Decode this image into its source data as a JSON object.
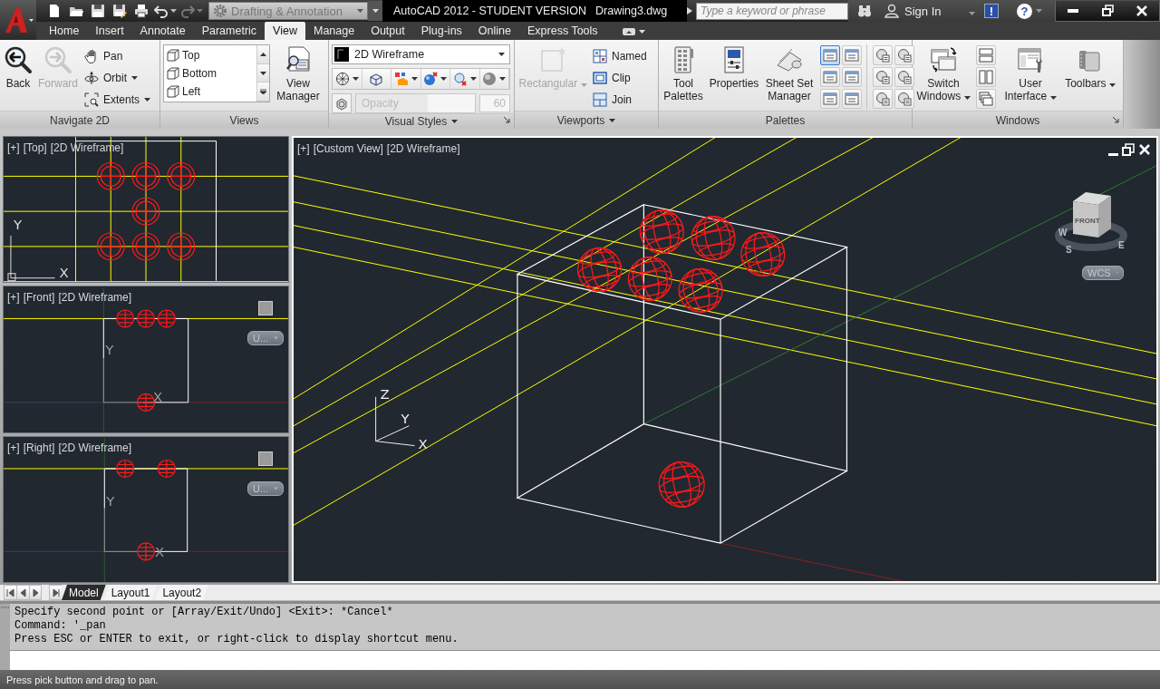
{
  "quick_access": {
    "tools": [
      {
        "kind": "new",
        "disabled": false,
        "dropdown": false
      },
      {
        "kind": "open",
        "disabled": false,
        "dropdown": false
      },
      {
        "kind": "save",
        "disabled": false,
        "dropdown": false
      },
      {
        "kind": "save_as",
        "disabled": false,
        "dropdown": false
      },
      {
        "kind": "print",
        "disabled": false,
        "dropdown": false
      },
      {
        "kind": "undo",
        "disabled": false,
        "dropdown": true
      },
      {
        "kind": "redo",
        "disabled": true,
        "dropdown": true
      }
    ],
    "workspace": "Drafting & Annotation"
  },
  "title": "AutoCAD 2012 - STUDENT VERSION",
  "document": "Drawing3.dwg",
  "search": {
    "placeholder": "Type a keyword or phrase"
  },
  "sign_in": "Sign In",
  "alert": "!",
  "help": "?",
  "tabs": [
    {
      "label": "Home",
      "selected": false
    },
    {
      "label": "Insert",
      "selected": false
    },
    {
      "label": "Annotate",
      "selected": false
    },
    {
      "label": "Parametric",
      "selected": false
    },
    {
      "label": "View",
      "selected": true
    },
    {
      "label": "Manage",
      "selected": false
    },
    {
      "label": "Output",
      "selected": false
    },
    {
      "label": "Plug-ins",
      "selected": false
    },
    {
      "label": "Online",
      "selected": false
    },
    {
      "label": "Express Tools",
      "selected": false
    }
  ],
  "ribbon": {
    "panels": [
      {
        "title": "Navigate 2D",
        "menu": false,
        "launcher": false,
        "columns": [
          {
            "kind": "large",
            "label": "Back",
            "disabled": false,
            "dropdown": false
          },
          {
            "kind": "large",
            "label": "Forward",
            "disabled": true,
            "dropdown": false
          },
          {
            "kind": "stack",
            "items": [
              {
                "label": "Pan",
                "dropdown": false
              },
              {
                "label": "Orbit",
                "dropdown": true
              },
              {
                "label": "Extents",
                "dropdown": true
              }
            ]
          }
        ]
      },
      {
        "title": "Views",
        "menu": false,
        "launcher": false,
        "columns": [
          {
            "kind": "list",
            "entries": [
              "Top",
              "Bottom",
              "Left"
            ]
          },
          {
            "kind": "large",
            "label": "View Manager",
            "disabled": false,
            "dropdown": false
          }
        ]
      },
      {
        "title": "Visual Styles",
        "menu": true,
        "launcher": true,
        "columns": [
          {
            "kind": "styles",
            "style": "2D Wireframe",
            "tools": [
              {
                "dropdown": true
              },
              {
                "dropdown": false
              },
              {
                "dropdown": true
              },
              {
                "dropdown": true
              },
              {
                "dropdown": true
              },
              {
                "dropdown": true
              }
            ],
            "opacity": {
              "label": "Opacity",
              "value": "60",
              "level": 0.6,
              "disabled": true
            }
          }
        ]
      },
      {
        "title": "Viewports",
        "menu": true,
        "launcher": false,
        "columns": [
          {
            "kind": "large",
            "label": "Rectangular",
            "disabled": true,
            "dropdown": true
          },
          {
            "kind": "stack",
            "items": [
              {
                "label": "Named",
                "dropdown": false
              },
              {
                "label": "Clip",
                "dropdown": false
              },
              {
                "label": "Join",
                "dropdown": false
              }
            ]
          }
        ]
      },
      {
        "title": "Palettes",
        "menu": false,
        "launcher": false,
        "columns": [
          {
            "kind": "large",
            "label": "Tool Palettes",
            "disabled": false,
            "dropdown": false
          },
          {
            "kind": "large",
            "label": "Properties",
            "disabled": false,
            "dropdown": false
          },
          {
            "kind": "large",
            "label": "Sheet Set Manager",
            "disabled": false,
            "dropdown": false
          },
          {
            "kind": "icons",
            "items": [
              {
                "selected": true
              },
              {
                "selected": false
              },
              {
                "selected": false
              },
              {
                "selected": false
              },
              {
                "selected": false
              },
              {
                "selected": false
              }
            ]
          },
          {
            "kind": "icons",
            "items": [
              {
                "selected": false
              },
              {
                "selected": false
              },
              {
                "selected": false
              },
              {
                "selected": false
              },
              {
                "selected": false
              },
              {
                "selected": false
              }
            ]
          }
        ]
      },
      {
        "title": "Windows",
        "menu": false,
        "launcher": true,
        "columns": [
          {
            "kind": "large",
            "label": "Switch Windows",
            "disabled": false,
            "dropdown": true
          },
          {
            "kind": "icons",
            "items": [
              {
                "selected": false
              },
              {
                "selected": false
              },
              {
                "selected": false
              }
            ]
          },
          {
            "kind": "large",
            "label": "User Interface",
            "disabled": false,
            "dropdown": true
          },
          {
            "kind": "large",
            "label": "Toolbars",
            "disabled": false,
            "dropdown": true
          }
        ]
      }
    ]
  },
  "viewports": [
    {
      "kind": "top",
      "active": false,
      "menus": [
        "[+]",
        "[Top]",
        "[2D Wireframe]"
      ],
      "axis_labels": [
        "Y",
        "X"
      ]
    },
    {
      "kind": "front",
      "active": false,
      "menus": [
        "[+]",
        "[Front]",
        "[2D Wireframe]"
      ],
      "axis_labels": [
        "Y",
        "X"
      ],
      "ucs_menu": "U..."
    },
    {
      "kind": "right",
      "active": false,
      "menus": [
        "[+]",
        "[Right]",
        "[2D Wireframe]"
      ],
      "axis_labels": [
        "Y",
        "X"
      ],
      "ucs_menu": "U..."
    },
    {
      "kind": "custom",
      "active": true,
      "menus": [
        "[+]",
        "[Custom View]",
        "[2D Wireframe]"
      ],
      "axis_labels": [
        "Z",
        "Y",
        "X"
      ],
      "viewcube": {
        "face": "FRONT",
        "compass": [
          "W",
          "S",
          "E"
        ]
      },
      "ucs_menu": "WCS"
    }
  ],
  "layout_tabs": [
    {
      "label": "Model",
      "selected": true
    },
    {
      "label": "Layout1",
      "selected": false
    },
    {
      "label": "Layout2",
      "selected": false
    }
  ],
  "command": {
    "history": [
      "Specify second point or [Array/Exit/Undo] <Exit>: *Cancel*",
      "Command: '_pan",
      "Press ESC or ENTER to exit, or right-click to display shortcut menu."
    ]
  },
  "status_bar": "Press pick button and drag to pan."
}
